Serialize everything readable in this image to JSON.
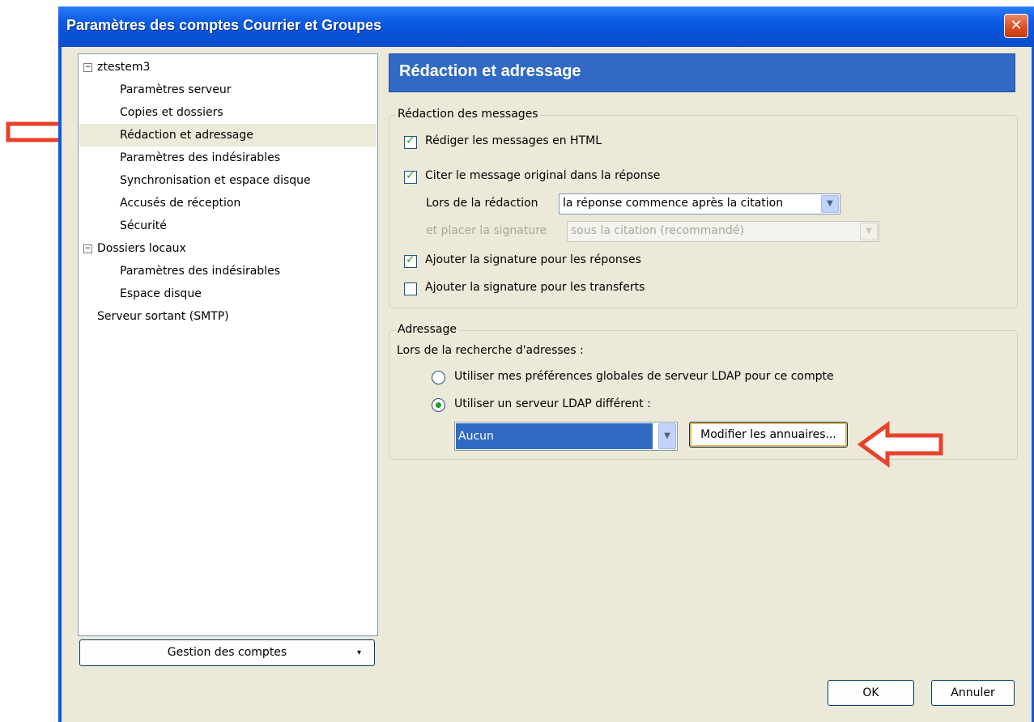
{
  "window": {
    "title": "Paramètres des comptes Courrier et Groupes",
    "close_glyph": "✕"
  },
  "tree": {
    "items": [
      {
        "label": "ztestem3",
        "expander": "−"
      },
      {
        "label": "Paramètres serveur"
      },
      {
        "label": "Copies et dossiers"
      },
      {
        "label": "Rédaction et adressage",
        "selected": true
      },
      {
        "label": "Paramètres des indésirables"
      },
      {
        "label": "Synchronisation et espace disque"
      },
      {
        "label": "Accusés de réception"
      },
      {
        "label": "Sécurité"
      },
      {
        "label": "Dossiers locaux",
        "expander": "−"
      },
      {
        "label": "Paramètres des indésirables"
      },
      {
        "label": "Espace disque"
      },
      {
        "label": "Serveur sortant (SMTP)"
      }
    ],
    "manage_button": "Gestion des comptes",
    "manage_arrow": "▾"
  },
  "panel": {
    "title": "Rédaction et adressage",
    "composition": {
      "legend": "Rédaction des messages",
      "html_checkbox": {
        "label": "Rédiger les messages en HTML",
        "checked": true
      },
      "quote_checkbox": {
        "label": "Citer le message original dans la réponse",
        "checked": true
      },
      "reply_label": "Lors de la rédaction",
      "reply_value": "la réponse commence après la citation",
      "signature_label": "et placer la signature",
      "signature_value": "sous la citation (recommandé)",
      "sig_replies_checkbox": {
        "label": "Ajouter la signature pour les réponses",
        "checked": true
      },
      "sig_forwards_checkbox": {
        "label": "Ajouter la signature pour les transferts",
        "checked": false
      }
    },
    "addressing": {
      "legend": "Adressage",
      "lookup_label": "Lors de la recherche d'adresses :",
      "global_radio": {
        "label": "Utiliser mes préférences globales de serveur LDAP pour ce compte",
        "selected": false
      },
      "different_radio": {
        "label": "Utiliser un serveur LDAP différent :",
        "selected": true
      },
      "ldap_value": "Aucun",
      "edit_directories_button": "Modifier les annuaires..."
    }
  },
  "footer": {
    "ok": "OK",
    "cancel": "Annuler"
  },
  "colors": {
    "title_blue": "#0b5be0",
    "header_blue": "#316ac5",
    "check_green": "#21a121",
    "annotation_red": "#e8412a"
  },
  "icons": {
    "dropdown": "chevron-down-icon",
    "checkmark": "check-icon",
    "annotation": "arrow-icon"
  }
}
